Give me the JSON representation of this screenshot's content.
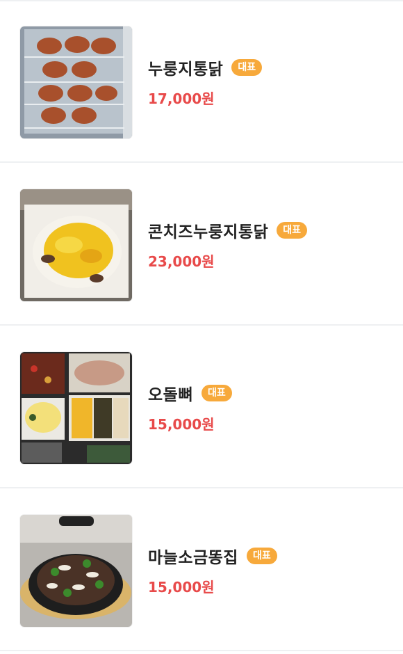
{
  "menu": {
    "items": [
      {
        "name": "누룽지통닭",
        "badge": "대표",
        "price": "17,000원"
      },
      {
        "name": "콘치즈누룽지통닭",
        "badge": "대표",
        "price": "23,000원"
      },
      {
        "name": "오돌뼈",
        "badge": "대표",
        "price": "15,000원"
      },
      {
        "name": "마늘소금똥집",
        "badge": "대표",
        "price": "15,000원"
      }
    ]
  },
  "colors": {
    "badge": "#f7a93b",
    "price": "#e84a4a",
    "name": "#222222",
    "divider": "#eef0f2"
  }
}
